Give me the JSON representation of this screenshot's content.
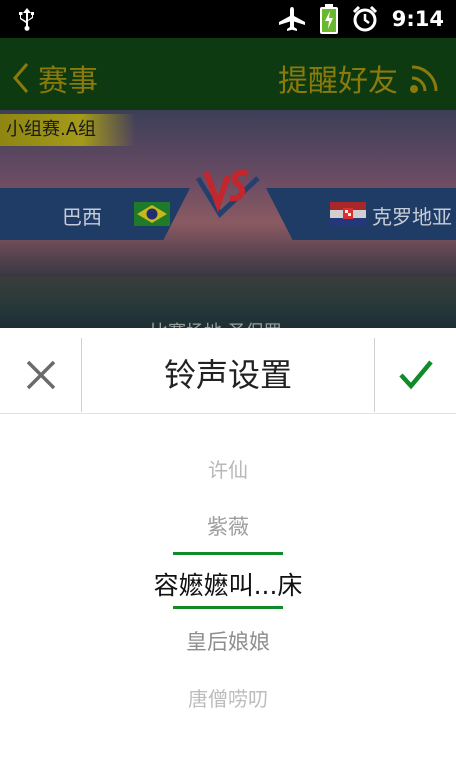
{
  "status_bar": {
    "time": "9:14",
    "icons": [
      "usb-icon",
      "airplane-icon",
      "battery-charging-icon",
      "alarm-icon"
    ]
  },
  "app_bar": {
    "back_label": "赛事",
    "action_label": "提醒好友",
    "accent_color": "#8a7a0c",
    "bar_color": "#0d3a10"
  },
  "match": {
    "group": "小组赛.A组",
    "home_team": "巴西",
    "away_team": "克罗地亚",
    "venue": "比赛场地 圣保罗"
  },
  "dialog": {
    "title": "铃声设置",
    "cancel_icon": "close-icon",
    "confirm_icon": "check-icon",
    "accent_color": "#0f8b2a"
  },
  "picker": {
    "items": [
      "许仙",
      "紫薇",
      "容嬷嬷叫...床",
      "皇后娘娘",
      "唐僧唠叨"
    ],
    "selected_index": 2
  }
}
